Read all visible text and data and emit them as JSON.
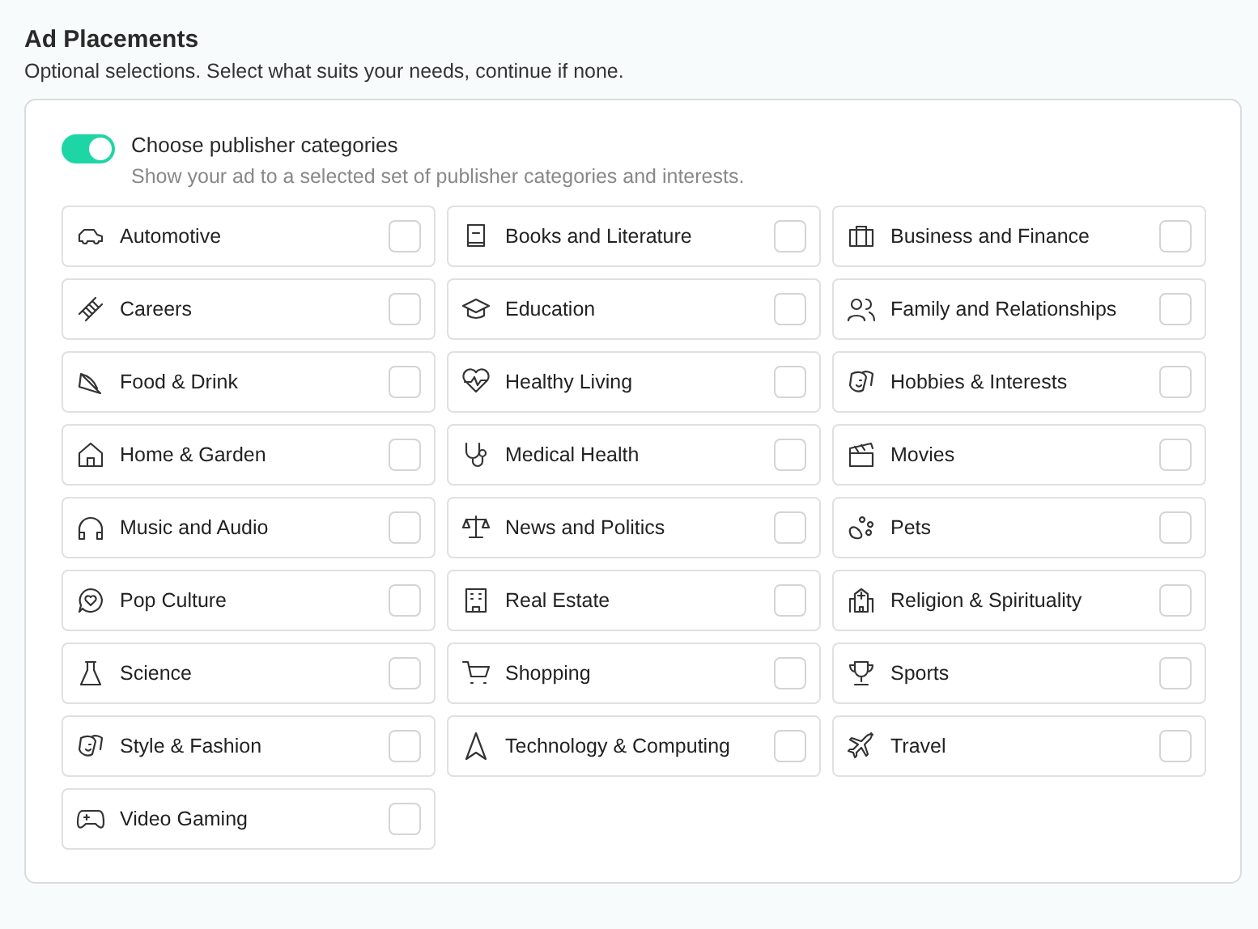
{
  "section": {
    "title": "Ad Placements",
    "subtitle": "Optional selections. Select what suits your needs, continue if none."
  },
  "toggle": {
    "label": "Choose publisher categories",
    "description": "Show your ad to a selected set of publisher categories and interests.",
    "on": true
  },
  "categories": [
    {
      "label": "Automotive",
      "checked": false
    },
    {
      "label": "Books and Literature",
      "checked": false
    },
    {
      "label": "Business and Finance",
      "checked": false
    },
    {
      "label": "Careers",
      "checked": false
    },
    {
      "label": "Education",
      "checked": false
    },
    {
      "label": "Family and Relationships",
      "checked": false
    },
    {
      "label": "Food & Drink",
      "checked": false
    },
    {
      "label": "Healthy Living",
      "checked": false
    },
    {
      "label": "Hobbies & Interests",
      "checked": false
    },
    {
      "label": "Home & Garden",
      "checked": false
    },
    {
      "label": "Medical Health",
      "checked": false
    },
    {
      "label": "Movies",
      "checked": false
    },
    {
      "label": "Music and Audio",
      "checked": false
    },
    {
      "label": "News and Politics",
      "checked": false
    },
    {
      "label": "Pets",
      "checked": false
    },
    {
      "label": "Pop Culture",
      "checked": false
    },
    {
      "label": "Real Estate",
      "checked": false
    },
    {
      "label": "Religion & Spirituality",
      "checked": false
    },
    {
      "label": "Science",
      "checked": false
    },
    {
      "label": "Shopping",
      "checked": false
    },
    {
      "label": "Sports",
      "checked": false
    },
    {
      "label": "Style & Fashion",
      "checked": false
    },
    {
      "label": "Technology & Computing",
      "checked": false
    },
    {
      "label": "Travel",
      "checked": false
    },
    {
      "label": "Video Gaming",
      "checked": false
    }
  ]
}
